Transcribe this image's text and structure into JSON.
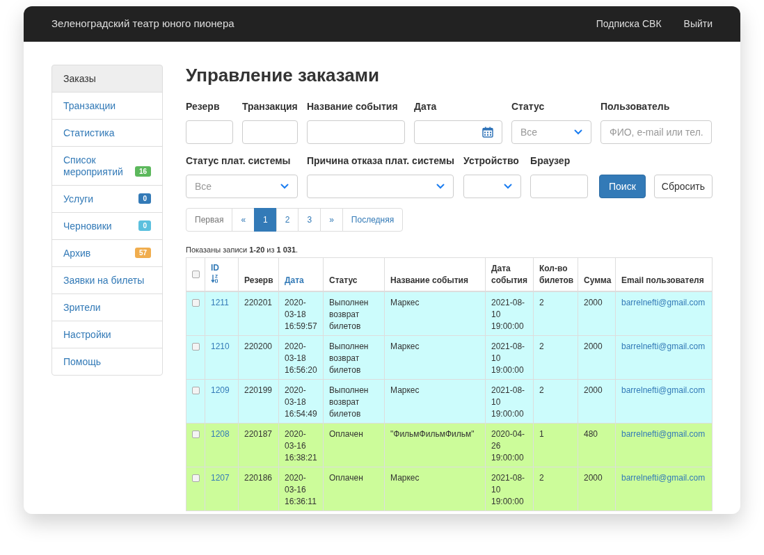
{
  "navbar": {
    "brand": "Зеленоградский театр юного пионера",
    "links": [
      "Подписка СВК",
      "Выйти"
    ]
  },
  "sidebar": {
    "items": [
      {
        "label": "Заказы",
        "selected": true
      },
      {
        "label": "Транзакции",
        "selected": false
      },
      {
        "label": "Статистика",
        "selected": false
      },
      {
        "label": "Список мероприятий",
        "selected": false,
        "badge": "16",
        "color": "#5cb85c"
      },
      {
        "label": "Услуги",
        "selected": false,
        "badge": "0",
        "color": "#337ab7"
      },
      {
        "label": "Черновики",
        "selected": false,
        "badge": "0",
        "color": "#5bc0de"
      },
      {
        "label": "Архив",
        "selected": false,
        "badge": "57",
        "color": "#f0ad4e"
      },
      {
        "label": "Заявки на билеты",
        "selected": false
      },
      {
        "label": "Зрители",
        "selected": false
      },
      {
        "label": "Настройки",
        "selected": false
      },
      {
        "label": "Помощь",
        "selected": false
      }
    ]
  },
  "title": "Управление заказами",
  "filter_rows": [
    [
      {
        "label": "Резерв",
        "kind": "text"
      },
      {
        "label": "Транзакция",
        "kind": "text"
      },
      {
        "label": "Название события",
        "kind": "text"
      },
      {
        "label": "Дата",
        "kind": "date"
      },
      {
        "label": "Статус",
        "kind": "select",
        "value": "Все"
      },
      {
        "label": "Пользователь",
        "kind": "text",
        "placeholder": "ФИО, e-mail или тел."
      }
    ],
    [
      {
        "label": "Статус плат. системы",
        "kind": "select",
        "value": "Все"
      },
      {
        "label": "Причина отказа плат. системы",
        "kind": "select"
      },
      {
        "label": "Устройство",
        "kind": "select"
      },
      {
        "label": "Браузер",
        "kind": "text"
      }
    ]
  ],
  "buttons": [
    {
      "label": "Поиск",
      "kind": "primary"
    },
    {
      "label": "Сбросить",
      "kind": "default"
    }
  ],
  "pagination": [
    {
      "label": "Первая",
      "selected": false,
      "disabled": true
    },
    {
      "label": "«",
      "selected": false,
      "disabled": false
    },
    {
      "label": "1",
      "selected": true,
      "disabled": false
    },
    {
      "label": "2",
      "selected": false,
      "disabled": false
    },
    {
      "label": "3",
      "selected": false,
      "disabled": false
    },
    {
      "label": "»",
      "selected": false,
      "disabled": false
    },
    {
      "label": "Последняя",
      "selected": false,
      "disabled": false
    }
  ],
  "summary": "Показаны записи **1-20** из **1 031**.",
  "table": {
    "header_checked": false,
    "columns": [
      {
        "label": "ID",
        "link": true,
        "sorted": true
      },
      {
        "label": "Резерв",
        "link": false,
        "sorted": false
      },
      {
        "label": "Дата",
        "link": true,
        "sorted": false
      },
      {
        "label": "Статус",
        "link": false,
        "sorted": false
      },
      {
        "label": "Название события",
        "link": false,
        "sorted": false
      },
      {
        "label": "Дата события",
        "link": false,
        "sorted": false
      },
      {
        "label": "Кол-во билетов",
        "link": false,
        "sorted": false
      },
      {
        "label": "Сумма",
        "link": false,
        "sorted": false
      },
      {
        "label": "Email пользователя",
        "link": false,
        "sorted": false
      }
    ],
    "rows": [
      {
        "color": "#ccfcfc",
        "checked": false,
        "cells": [
          "1211",
          "220201",
          "2020-03-18 16:59:57",
          "Выполнен возврат билетов",
          "Маркес",
          "2021-08-10 19:00:00",
          "2",
          "2000",
          "barrelnefti@gmail.com"
        ]
      },
      {
        "color": "#ccfcfc",
        "checked": false,
        "cells": [
          "1210",
          "220200",
          "2020-03-18 16:56:20",
          "Выполнен возврат билетов",
          "Маркес",
          "2021-08-10 19:00:00",
          "2",
          "2000",
          "barrelnefti@gmail.com"
        ]
      },
      {
        "color": "#ccfcfc",
        "checked": false,
        "cells": [
          "1209",
          "220199",
          "2020-03-18 16:54:49",
          "Выполнен возврат билетов",
          "Маркес",
          "2021-08-10 19:00:00",
          "2",
          "2000",
          "barrelnefti@gmail.com"
        ]
      },
      {
        "color": "#ccfc9a",
        "checked": false,
        "cells": [
          "1208",
          "220187",
          "2020-03-16 16:38:21",
          "Оплачен",
          "\"ФильмФильмФильм\"",
          "2020-04-26 19:00:00",
          "1",
          "480",
          "barrelnefti@gmail.com"
        ]
      },
      {
        "color": "#ccfc9a",
        "checked": false,
        "cells": [
          "1207",
          "220186",
          "2020-03-16 16:36:11",
          "Оплачен",
          "Маркес",
          "2021-08-10 19:00:00",
          "2",
          "2000",
          "barrelnefti@gmail.com"
        ]
      }
    ]
  }
}
